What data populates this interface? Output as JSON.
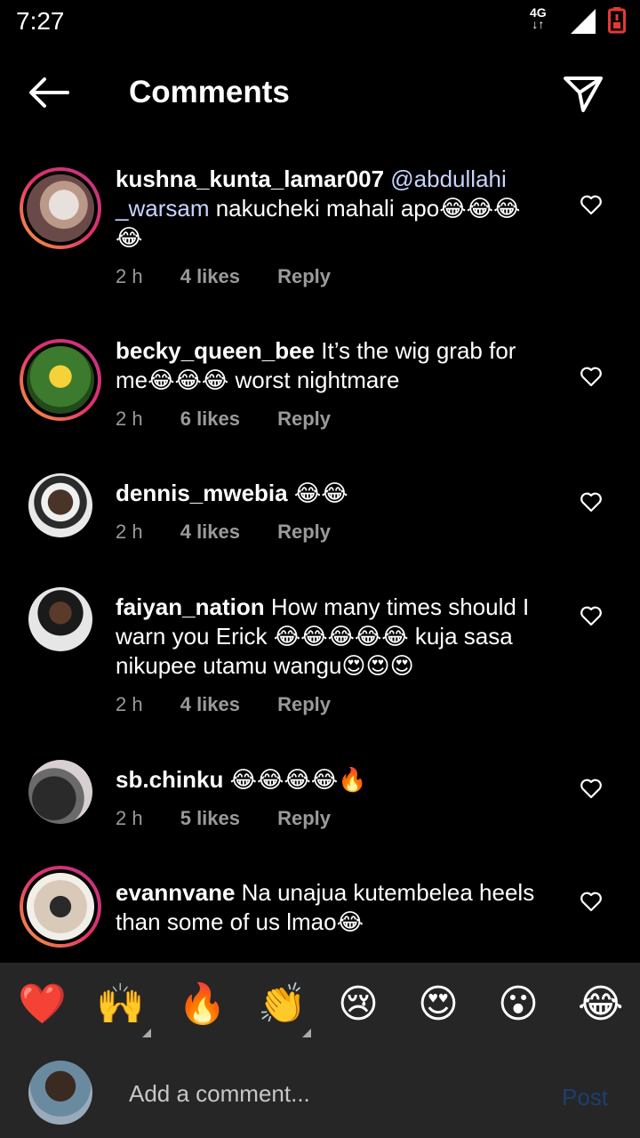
{
  "status_bar": {
    "time": "7:27",
    "network": "4G"
  },
  "header": {
    "title": "Comments"
  },
  "comments": [
    {
      "user": "kushna_kunta_lamar007",
      "mention": "@abdullahi _warsam",
      "text": "nakucheki mahali apo😂😂😂 😂",
      "time": "2 h",
      "likes": "4 likes",
      "reply": "Reply"
    },
    {
      "user": "becky_queen_bee",
      "text": "It’s the wig grab for me😂😂😂 worst nightmare",
      "time": "2 h",
      "likes": "6 likes",
      "reply": "Reply"
    },
    {
      "user": "dennis_mwebia",
      "text": "😂😂",
      "time": "2 h",
      "likes": "4 likes",
      "reply": "Reply"
    },
    {
      "user": "faiyan_nation",
      "text": "How many times should I warn you Erick 😂😂😂😂😂 kuja sasa nikupee utamu wangu😍😍😍",
      "time": "2 h",
      "likes": "4 likes",
      "reply": "Reply"
    },
    {
      "user": "sb.chinku",
      "text": "😂😂😂😂🔥",
      "time": "2 h",
      "likes": "5 likes",
      "reply": "Reply"
    },
    {
      "user": "evannvane",
      "text": "Na unajua kutembelea heels than some of us lmao😂",
      "time": "",
      "likes": "",
      "reply": ""
    }
  ],
  "emoji_bar": [
    "❤️",
    "🙌",
    "🔥",
    "👏",
    "😢",
    "😍",
    "😮",
    "😂"
  ],
  "input": {
    "placeholder": "Add a comment...",
    "post_label": "Post"
  },
  "colors": {
    "accent_disabled": "#1c3f6e",
    "story_ring": "#e1306c",
    "mention": "#c8d4ff"
  }
}
